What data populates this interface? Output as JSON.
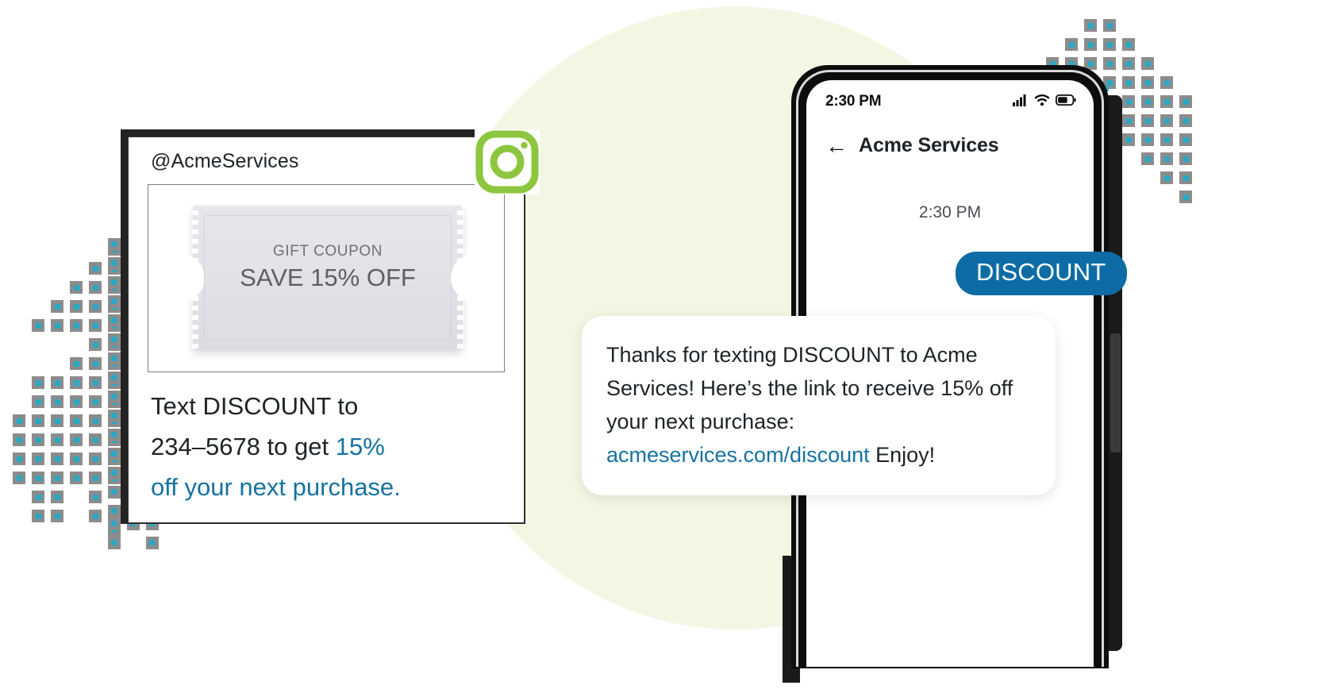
{
  "colors": {
    "blob": "#f2f7e4",
    "accent_blue": "#1572a2",
    "bubble_blue": "#0d6ca5",
    "instagram_green": "#8cc63f",
    "pixel_gray": "#8c8c8c",
    "pixel_cyan": "#27a9c6"
  },
  "instagram_post": {
    "handle": "@AcmeServices",
    "platform_icon": "instagram-icon",
    "coupon": {
      "kicker": "GIFT COUPON",
      "headline": "SAVE 15% OFF"
    },
    "caption": {
      "line1_plain": "Text DISCOUNT to",
      "line2_plain": "234–5678 to get ",
      "line2_link": "15%",
      "line3_link": "off your next purchase."
    }
  },
  "phone": {
    "status_bar": {
      "time": "2:30 PM",
      "icons": [
        "cellular-signal-icon",
        "wifi-icon",
        "battery-icon"
      ]
    },
    "conversation_header": {
      "back_icon": "back-arrow-icon",
      "title": "Acme Services"
    },
    "chat_timestamp": "2:30 PM",
    "messages": [
      {
        "direction": "outgoing",
        "text": "DISCOUNT"
      },
      {
        "direction": "incoming",
        "text_before_link": "Thanks for texting DISCOUNT to Acme Services! Here’s the link to receive 15% off your next purchase: ",
        "link_text": "acmeservices.com/discount",
        "text_after_link": " Enjoy!"
      }
    ]
  }
}
